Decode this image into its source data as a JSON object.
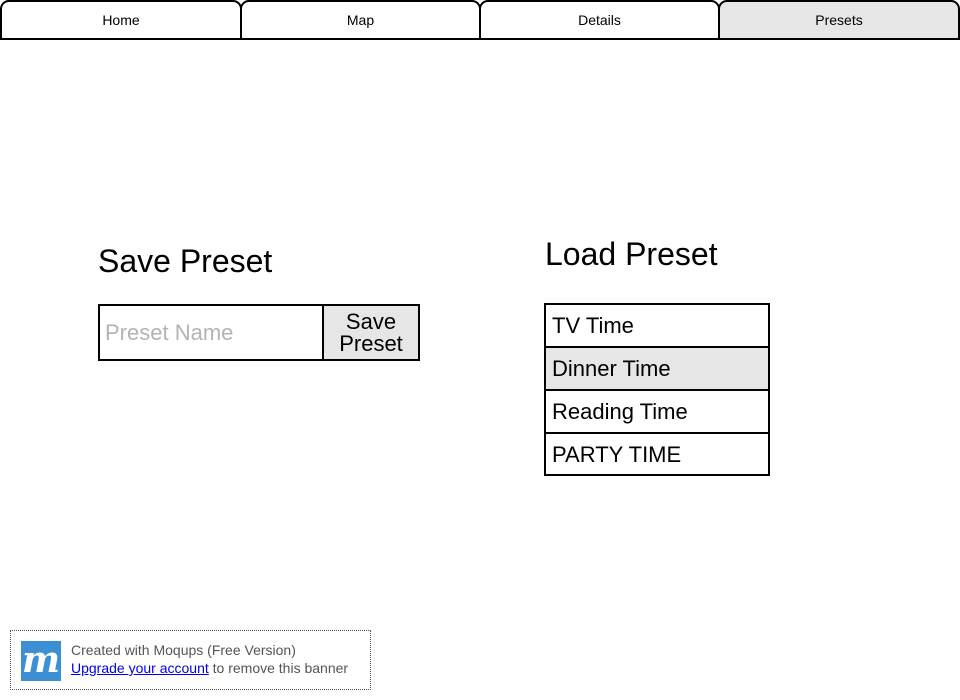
{
  "tabs": [
    {
      "label": "Home",
      "active": false
    },
    {
      "label": "Map",
      "active": false
    },
    {
      "label": "Details",
      "active": false
    },
    {
      "label": "Presets",
      "active": true
    }
  ],
  "save_preset": {
    "heading": "Save Preset",
    "input_value": "",
    "input_placeholder": "Preset Name",
    "button_label": "Save Preset"
  },
  "load_preset": {
    "heading": "Load Preset",
    "items": [
      {
        "label": "TV Time",
        "selected": false
      },
      {
        "label": "Dinner Time",
        "selected": true
      },
      {
        "label": "Reading Time",
        "selected": false
      },
      {
        "label": "PARTY TIME",
        "selected": false
      }
    ]
  },
  "banner": {
    "logo_text": "m",
    "line1": "Created with Moqups (Free Version)",
    "link_text": "Upgrade your account",
    "line2_suffix": " to remove this banner"
  },
  "colors": {
    "active_tab_bg": "#e6e6e6",
    "selected_item_bg": "#e6e6e6",
    "button_bg": "#e6e6e6",
    "placeholder": "#b3b3b3",
    "logo_bg": "#3d8fd4",
    "link": "#0000ee"
  }
}
